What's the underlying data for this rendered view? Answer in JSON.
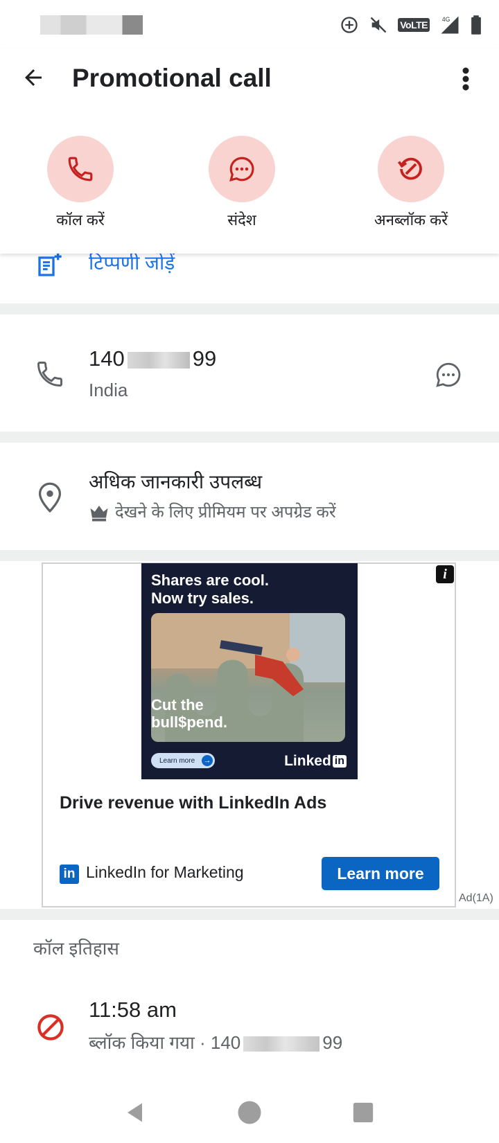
{
  "status_bar": {
    "volte_label": "VoLTE",
    "network_label": "4G"
  },
  "header": {
    "title": "Promotional call",
    "actions": [
      {
        "label": "कॉल करें",
        "icon": "phone-icon"
      },
      {
        "label": "संदेश",
        "icon": "message-icon"
      },
      {
        "label": "अनब्लॉक करें",
        "icon": "unblock-icon"
      }
    ]
  },
  "note": {
    "label": "टिप्पणी जोड़ें"
  },
  "phone": {
    "prefix": "140",
    "suffix": "99",
    "country": "India"
  },
  "info": {
    "title": "अधिक जानकारी उपलब्ध",
    "upgrade_text": "देखने के लिए प्रीमियम पर अपग्रेड करें"
  },
  "ad": {
    "info_icon_label": "i",
    "creative_headline_1": "Shares are cool.",
    "creative_headline_2": "Now try sales.",
    "creative_tagline_1": "Cut the",
    "creative_tagline_2": "bull$pend.",
    "creative_button": "Learn more",
    "creative_logo": "Linked",
    "creative_logo_in": "in",
    "headline": "Drive revenue with LinkedIn Ads",
    "advertiser_icon": "in",
    "advertiser": "LinkedIn for Marketing",
    "cta": "Learn more",
    "ad_label": "Ad(1A)"
  },
  "history": {
    "title": "कॉल इतिहास",
    "entries": [
      {
        "time": "11:58 am",
        "status": "ब्लॉक किया गया · 140",
        "suffix": "99"
      }
    ]
  },
  "colors": {
    "accent": "#1a73e8",
    "action_bg": "#f9d3d0",
    "action_icon": "#c5221f",
    "linkedin": "#0a66c2",
    "blocked": "#d93025"
  }
}
